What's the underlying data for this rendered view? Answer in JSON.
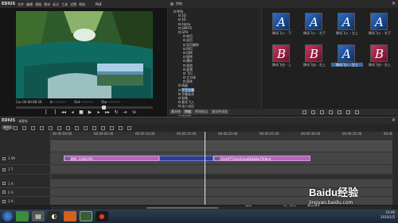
{
  "player": {
    "title": "EDIUS",
    "menu": [
      "文件",
      "编辑",
      "视图",
      "素材",
      "标记",
      "工具",
      "设置",
      "帮助"
    ],
    "mode_label": "PLR",
    "tc_cur_label": "Cur",
    "tc_cur": "00:00:08:16",
    "tc_in_label": "In",
    "tc_in": "--:--:--:--",
    "tc_out_label": "Out",
    "tc_out": "--:--:--:--",
    "tc_dur_label": "Dur",
    "tc_dur": "--:--:--:--"
  },
  "bin": {
    "title": "特效",
    "tree": [
      "转场",
      "2D",
      "3D",
      "Alpha",
      "SMPTE",
      "GPU",
      "单页",
      "双页",
      "双页翻转",
      "四页",
      "扭转",
      "旋转",
      "爆炸",
      "波浪",
      "涟漪",
      "飞行",
      "立方体",
      "球体",
      "高级",
      "手写字幕",
      "字幕混合",
      "划像",
      "柔化飞入",
      "淡入淡出",
      "激光",
      "软划像",
      "3D",
      "音频转场",
      "音频淡入",
      "音频淡出",
      "键"
    ],
    "tabs": [
      "素材库",
      "特效",
      "序列标记",
      "源文件浏览"
    ]
  },
  "effects": {
    "items": [
      {
        "letter": "A",
        "color": "blue",
        "caption": "移动飞入 - 下"
      },
      {
        "letter": "A",
        "color": "blue",
        "caption": "移动飞入 - 左下"
      },
      {
        "letter": "A",
        "color": "blue",
        "caption": "移动飞入 - 左上"
      },
      {
        "letter": "A",
        "color": "blue",
        "caption": "移动飞入 - 右下"
      },
      {
        "letter": "B",
        "color": "red",
        "caption": "移动飞出 - 上"
      },
      {
        "letter": "B",
        "color": "red",
        "caption": "移动飞出 - 左上"
      },
      {
        "letter": "A",
        "color": "blue",
        "caption": "移动飞入 - 左上"
      },
      {
        "letter": "B",
        "color": "red",
        "caption": "移动飞出 - 右上"
      }
    ]
  },
  "timeline": {
    "title": "EDIUS",
    "project": "未保存",
    "sequence_tab": "序列1",
    "ruler_labels": [
      "00:00:00:00",
      "00:00:05:00",
      "00:00:10:00",
      "00:00:15:00",
      "00:00:20:00",
      "00:00:25:00",
      "00:00:30:00",
      "00:00:35:00",
      "00:00:40:00"
    ],
    "playhead_tc": "00:00:08:21",
    "tracks": [
      {
        "name": "1 VA"
      },
      {
        "name": "1 T"
      },
      {
        "name": "1 A"
      },
      {
        "name": "2 A"
      },
      {
        "name": "3 A"
      }
    ],
    "clip1": "IMG_1294.JPG",
    "clip2": "[Unt]f77dcb3a3a684b8a7f09ed"
  },
  "status": {
    "left": "就绪",
    "mode": "插入模式",
    "right": "覆盖模式"
  },
  "taskbar": {
    "time": "10:46",
    "date": "2016/1/5"
  },
  "watermark": {
    "brand": "Baidu经验",
    "url": "jingyan.baidu.com"
  }
}
